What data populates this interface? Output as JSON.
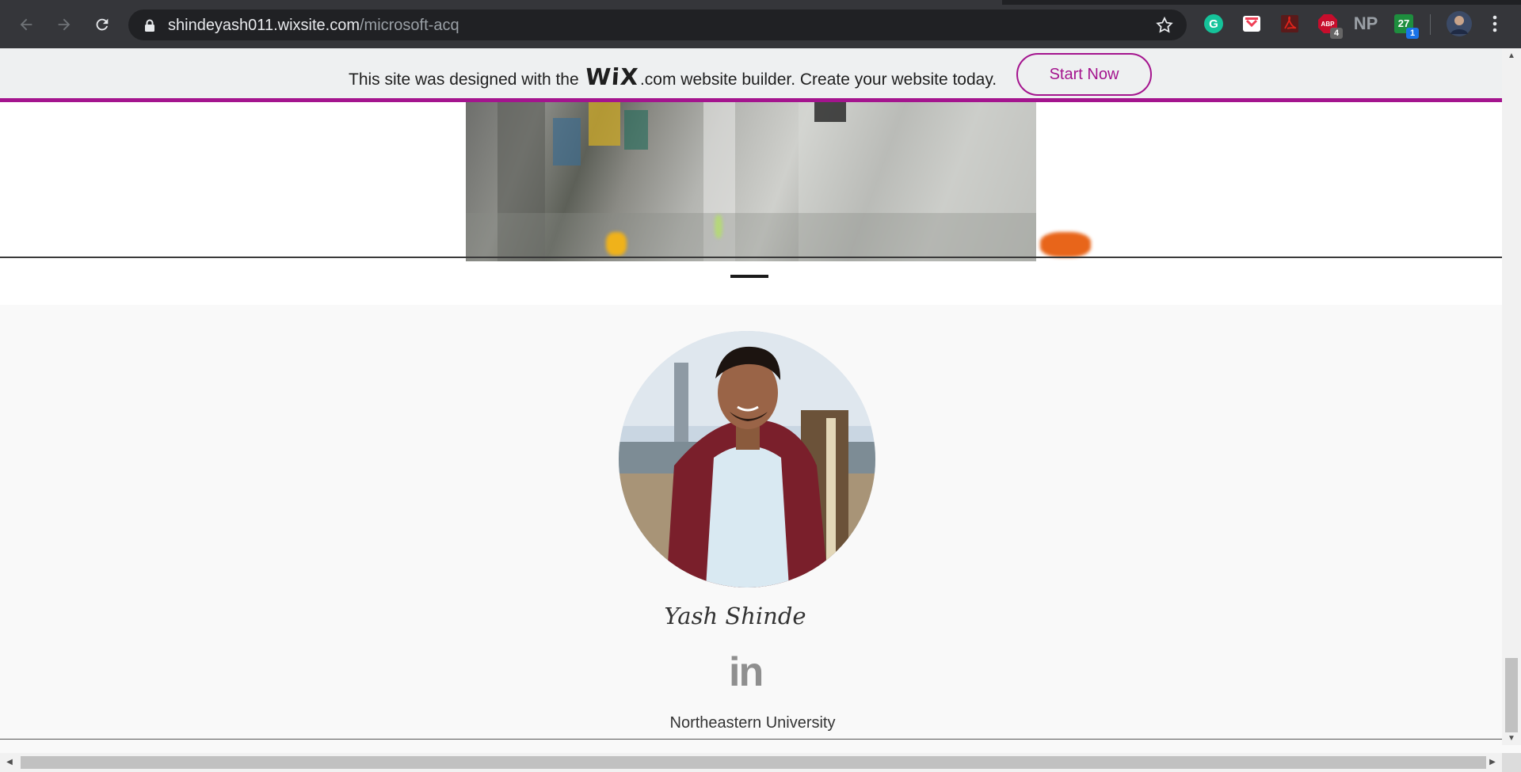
{
  "browser": {
    "url_domain": "shindeyash011.wixsite.com",
    "url_path": "/microsoft-acq",
    "extensions": [
      {
        "name": "grammarly-icon",
        "label": "G",
        "color": "#15c39a"
      },
      {
        "name": "pocket-icon",
        "label": "",
        "color": "#ef4056"
      },
      {
        "name": "acrobat-icon",
        "label": "",
        "color": "#e2231a"
      },
      {
        "name": "adblock-icon",
        "label": "ABP",
        "badge": "4",
        "color": "#c70d2c"
      },
      {
        "name": "np-icon",
        "label": "NP",
        "color": "#9aa0a6"
      },
      {
        "name": "calendar-ext-icon",
        "label": "27",
        "badge": "1",
        "color": "#1a73e8"
      }
    ]
  },
  "wix_banner": {
    "text_before": "This site was designed with the",
    "logo": "WiX",
    "text_after": ".com website builder. Create your website today.",
    "button_label": "Start Now",
    "accent": "#a4148e"
  },
  "profile": {
    "name": "Yash Shinde",
    "social_label": "in",
    "school": "Northeastern University"
  }
}
